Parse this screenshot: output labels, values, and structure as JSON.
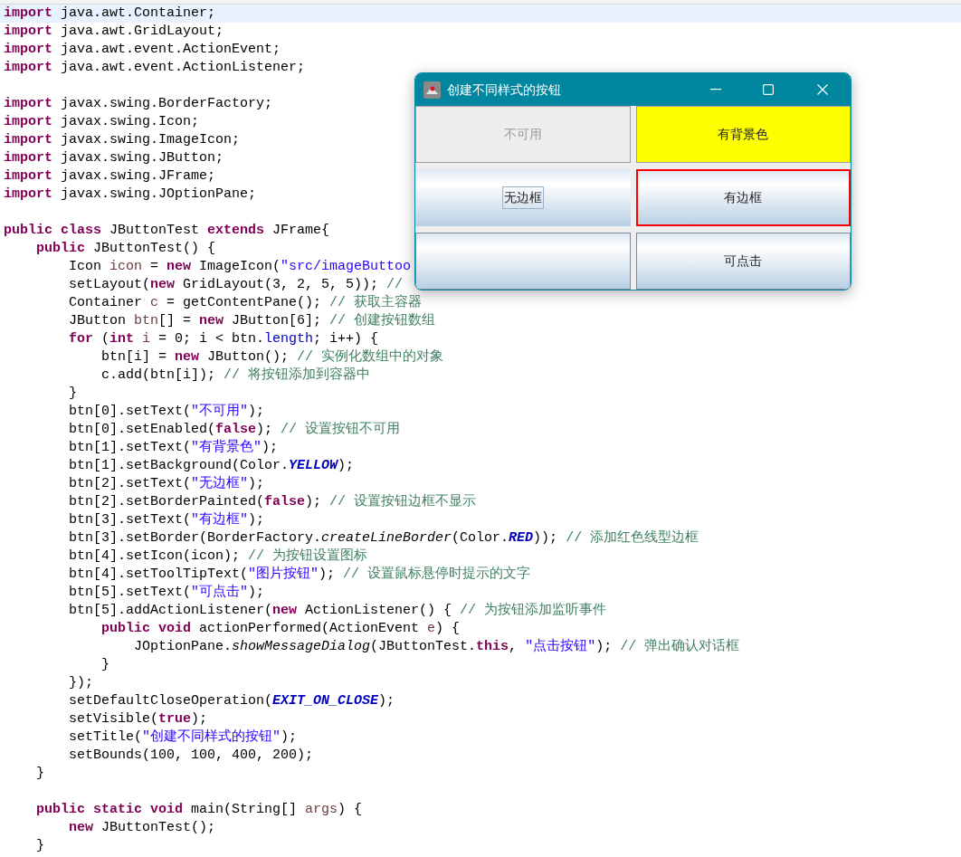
{
  "editor": {
    "lines": [
      {
        "kind": "code",
        "current": true,
        "tokens": [
          {
            "kind": "kw",
            "text": "import"
          },
          {
            "kind": "p",
            "text": " java.awt.Container;"
          }
        ]
      },
      {
        "kind": "code",
        "tokens": [
          {
            "kind": "kw",
            "text": "import"
          },
          {
            "kind": "p",
            "text": " java.awt.GridLayout;"
          }
        ]
      },
      {
        "kind": "code",
        "tokens": [
          {
            "kind": "kw",
            "text": "import"
          },
          {
            "kind": "p",
            "text": " java.awt.event.ActionEvent;"
          }
        ]
      },
      {
        "kind": "code",
        "tokens": [
          {
            "kind": "kw",
            "text": "import"
          },
          {
            "kind": "p",
            "text": " java.awt.event.ActionListener;"
          }
        ]
      },
      {
        "kind": "blank"
      },
      {
        "kind": "code",
        "tokens": [
          {
            "kind": "kw",
            "text": "import"
          },
          {
            "kind": "p",
            "text": " javax.swing.BorderFactory;"
          }
        ]
      },
      {
        "kind": "code",
        "tokens": [
          {
            "kind": "kw",
            "text": "import"
          },
          {
            "kind": "p",
            "text": " javax.swing.Icon;"
          }
        ]
      },
      {
        "kind": "code",
        "tokens": [
          {
            "kind": "kw",
            "text": "import"
          },
          {
            "kind": "p",
            "text": " javax.swing.ImageIcon;"
          }
        ]
      },
      {
        "kind": "code",
        "tokens": [
          {
            "kind": "kw",
            "text": "import"
          },
          {
            "kind": "p",
            "text": " javax.swing.JButton;"
          }
        ]
      },
      {
        "kind": "code",
        "tokens": [
          {
            "kind": "kw",
            "text": "import"
          },
          {
            "kind": "p",
            "text": " javax.swing.JFrame;"
          }
        ]
      },
      {
        "kind": "code",
        "tokens": [
          {
            "kind": "kw",
            "text": "import"
          },
          {
            "kind": "p",
            "text": " javax.swing.JOptionPane;"
          }
        ]
      },
      {
        "kind": "blank"
      },
      {
        "kind": "code",
        "tokens": [
          {
            "kind": "kw",
            "text": "public class"
          },
          {
            "kind": "p",
            "text": " JButtonTest "
          },
          {
            "kind": "kw",
            "text": "extends"
          },
          {
            "kind": "p",
            "text": " JFrame{"
          }
        ],
        "children": [
          {
            "kind": "code",
            "tokens": [
              {
                "kind": "kw",
                "text": "public"
              },
              {
                "kind": "p",
                "text": " JButtonTest() {"
              }
            ],
            "children": [
              {
                "kind": "code",
                "tokens": [
                  {
                    "kind": "p",
                    "text": "Icon "
                  },
                  {
                    "kind": "var",
                    "text": "icon"
                  },
                  {
                    "kind": "p",
                    "text": " = "
                  },
                  {
                    "kind": "kw",
                    "text": "new"
                  },
                  {
                    "kind": "p",
                    "text": " ImageIcon("
                  },
                  {
                    "kind": "str",
                    "text": "\"src/imageButtoo"
                  }
                ]
              },
              {
                "kind": "code",
                "tokens": [
                  {
                    "kind": "p",
                    "text": "setLayout("
                  },
                  {
                    "kind": "kw",
                    "text": "new"
                  },
                  {
                    "kind": "p",
                    "text": " GridLayout(3, 2, 5, 5)); "
                  },
                  {
                    "kind": "cm",
                    "text": "//"
                  }
                ]
              },
              {
                "kind": "code",
                "tokens": [
                  {
                    "kind": "p",
                    "text": "Container "
                  },
                  {
                    "kind": "var",
                    "text": "c"
                  },
                  {
                    "kind": "p",
                    "text": " = getContentPane(); "
                  },
                  {
                    "kind": "cm",
                    "text": "// 获取主容器"
                  }
                ]
              },
              {
                "kind": "code",
                "tokens": [
                  {
                    "kind": "p",
                    "text": "JButton "
                  },
                  {
                    "kind": "var",
                    "text": "btn"
                  },
                  {
                    "kind": "p",
                    "text": "[] = "
                  },
                  {
                    "kind": "kw",
                    "text": "new"
                  },
                  {
                    "kind": "p",
                    "text": " JButton[6]; "
                  },
                  {
                    "kind": "cm",
                    "text": "// 创建按钮数组"
                  }
                ]
              },
              {
                "kind": "code",
                "tokens": [
                  {
                    "kind": "kw",
                    "text": "for"
                  },
                  {
                    "kind": "p",
                    "text": " ("
                  },
                  {
                    "kind": "kw",
                    "text": "int"
                  },
                  {
                    "kind": "var",
                    "text": " i"
                  },
                  {
                    "kind": "p",
                    "text": " = 0; i < btn."
                  },
                  {
                    "kind": "fld",
                    "text": "length"
                  },
                  {
                    "kind": "p",
                    "text": "; i++) {"
                  }
                ],
                "children": [
                  {
                    "kind": "code",
                    "tokens": [
                      {
                        "kind": "p",
                        "text": "btn[i] = "
                      },
                      {
                        "kind": "kw",
                        "text": "new"
                      },
                      {
                        "kind": "p",
                        "text": " JButton(); "
                      },
                      {
                        "kind": "cm",
                        "text": "// 实例化数组中的对象"
                      }
                    ]
                  },
                  {
                    "kind": "code",
                    "tokens": [
                      {
                        "kind": "p",
                        "text": "c.add(btn[i]); "
                      },
                      {
                        "kind": "cm",
                        "text": "// 将按钮添加到容器中"
                      }
                    ]
                  }
                ]
              },
              {
                "kind": "code",
                "tokens": [
                  {
                    "kind": "p",
                    "text": "}"
                  }
                ]
              },
              {
                "kind": "code",
                "tokens": [
                  {
                    "kind": "p",
                    "text": "btn[0].setText("
                  },
                  {
                    "kind": "str",
                    "text": "\"不可用\""
                  },
                  {
                    "kind": "p",
                    "text": ");"
                  }
                ]
              },
              {
                "kind": "code",
                "tokens": [
                  {
                    "kind": "p",
                    "text": "btn[0].setEnabled("
                  },
                  {
                    "kind": "kw",
                    "text": "false"
                  },
                  {
                    "kind": "p",
                    "text": "); "
                  },
                  {
                    "kind": "cm",
                    "text": "// 设置按钮不可用"
                  }
                ]
              },
              {
                "kind": "code",
                "tokens": [
                  {
                    "kind": "p",
                    "text": "btn[1].setText("
                  },
                  {
                    "kind": "str",
                    "text": "\"有背景色\""
                  },
                  {
                    "kind": "p",
                    "text": ");"
                  }
                ]
              },
              {
                "kind": "code",
                "tokens": [
                  {
                    "kind": "p",
                    "text": "btn[1].setBackground(Color."
                  },
                  {
                    "kind": "const",
                    "text": "YELLOW"
                  },
                  {
                    "kind": "p",
                    "text": ");"
                  }
                ]
              },
              {
                "kind": "code",
                "tokens": [
                  {
                    "kind": "p",
                    "text": "btn[2].setText("
                  },
                  {
                    "kind": "str",
                    "text": "\"无边框\""
                  },
                  {
                    "kind": "p",
                    "text": ");"
                  }
                ]
              },
              {
                "kind": "code",
                "tokens": [
                  {
                    "kind": "p",
                    "text": "btn[2].setBorderPainted("
                  },
                  {
                    "kind": "kw",
                    "text": "false"
                  },
                  {
                    "kind": "p",
                    "text": "); "
                  },
                  {
                    "kind": "cm",
                    "text": "// 设置按钮边框不显示"
                  }
                ]
              },
              {
                "kind": "code",
                "tokens": [
                  {
                    "kind": "p",
                    "text": "btn[3].setText("
                  },
                  {
                    "kind": "str",
                    "text": "\"有边框\""
                  },
                  {
                    "kind": "p",
                    "text": ");"
                  }
                ]
              },
              {
                "kind": "code",
                "tokens": [
                  {
                    "kind": "p",
                    "text": "btn[3].setBorder(BorderFactory."
                  },
                  {
                    "kind": "it",
                    "text": "createLineBorder"
                  },
                  {
                    "kind": "p",
                    "text": "(Color."
                  },
                  {
                    "kind": "const",
                    "text": "RED"
                  },
                  {
                    "kind": "p",
                    "text": ")); "
                  },
                  {
                    "kind": "cm",
                    "text": "// 添加红色线型边框"
                  }
                ]
              },
              {
                "kind": "code",
                "tokens": [
                  {
                    "kind": "p",
                    "text": "btn[4].setIcon(icon); "
                  },
                  {
                    "kind": "cm",
                    "text": "// 为按钮设置图标"
                  }
                ]
              },
              {
                "kind": "code",
                "tokens": [
                  {
                    "kind": "p",
                    "text": "btn[4].setToolTipText("
                  },
                  {
                    "kind": "str",
                    "text": "\"图片按钮\""
                  },
                  {
                    "kind": "p",
                    "text": "); "
                  },
                  {
                    "kind": "cm",
                    "text": "// 设置鼠标悬停时提示的文字"
                  }
                ]
              },
              {
                "kind": "code",
                "tokens": [
                  {
                    "kind": "p",
                    "text": "btn[5].setText("
                  },
                  {
                    "kind": "str",
                    "text": "\"可点击\""
                  },
                  {
                    "kind": "p",
                    "text": ");"
                  }
                ]
              },
              {
                "kind": "code",
                "tokens": [
                  {
                    "kind": "p",
                    "text": "btn[5].addActionListener("
                  },
                  {
                    "kind": "kw",
                    "text": "new"
                  },
                  {
                    "kind": "p",
                    "text": " ActionListener() { "
                  },
                  {
                    "kind": "cm",
                    "text": "// 为按钮添加监听事件"
                  }
                ],
                "children": [
                  {
                    "kind": "code",
                    "tokens": [
                      {
                        "kind": "kw",
                        "text": "public void"
                      },
                      {
                        "kind": "p",
                        "text": " actionPerformed(ActionEvent "
                      },
                      {
                        "kind": "var",
                        "text": "e"
                      },
                      {
                        "kind": "p",
                        "text": ") {"
                      }
                    ],
                    "children": [
                      {
                        "kind": "code",
                        "tokens": [
                          {
                            "kind": "p",
                            "text": "JOptionPane."
                          },
                          {
                            "kind": "it",
                            "text": "showMessageDialog"
                          },
                          {
                            "kind": "p",
                            "text": "(JButtonTest."
                          },
                          {
                            "kind": "kw",
                            "text": "this"
                          },
                          {
                            "kind": "p",
                            "text": ", "
                          },
                          {
                            "kind": "str",
                            "text": "\"点击按钮\""
                          },
                          {
                            "kind": "p",
                            "text": "); "
                          },
                          {
                            "kind": "cm",
                            "text": "// 弹出确认对话框"
                          }
                        ]
                      }
                    ]
                  },
                  {
                    "kind": "code",
                    "tokens": [
                      {
                        "kind": "p",
                        "text": "}"
                      }
                    ]
                  }
                ]
              },
              {
                "kind": "code",
                "tokens": [
                  {
                    "kind": "p",
                    "text": "});"
                  }
                ]
              },
              {
                "kind": "code",
                "tokens": [
                  {
                    "kind": "p",
                    "text": "setDefaultCloseOperation("
                  },
                  {
                    "kind": "const",
                    "text": "EXIT_ON_CLOSE"
                  },
                  {
                    "kind": "p",
                    "text": ");"
                  }
                ]
              },
              {
                "kind": "code",
                "tokens": [
                  {
                    "kind": "p",
                    "text": "setVisible("
                  },
                  {
                    "kind": "kw",
                    "text": "true"
                  },
                  {
                    "kind": "p",
                    "text": ");"
                  }
                ]
              },
              {
                "kind": "code",
                "tokens": [
                  {
                    "kind": "p",
                    "text": "setTitle("
                  },
                  {
                    "kind": "str",
                    "text": "\"创建不同样式的按钮\""
                  },
                  {
                    "kind": "p",
                    "text": ");"
                  }
                ]
              },
              {
                "kind": "code",
                "tokens": [
                  {
                    "kind": "p",
                    "text": "setBounds(100, 100, 400, 200);"
                  }
                ]
              }
            ]
          },
          {
            "kind": "code",
            "tokens": [
              {
                "kind": "p",
                "text": "}"
              }
            ]
          },
          {
            "kind": "blank"
          },
          {
            "kind": "code",
            "tokens": [
              {
                "kind": "kw",
                "text": "public static void"
              },
              {
                "kind": "p",
                "text": " main(String[] "
              },
              {
                "kind": "var",
                "text": "args"
              },
              {
                "kind": "p",
                "text": ") {"
              }
            ],
            "children": [
              {
                "kind": "code",
                "tokens": [
                  {
                    "kind": "kw",
                    "text": "new"
                  },
                  {
                    "kind": "p",
                    "text": " JButtonTest();"
                  }
                ]
              }
            ]
          },
          {
            "kind": "code",
            "tokens": [
              {
                "kind": "p",
                "text": "}"
              }
            ]
          }
        ]
      }
    ]
  },
  "window": {
    "title": "创建不同样式的按钮",
    "buttons": [
      {
        "kind": "plain",
        "label": "不可用",
        "disabled": true,
        "focused": false
      },
      {
        "kind": "colored",
        "label": "有背景色",
        "color": "#ffff00",
        "disabled": false,
        "focused": false
      },
      {
        "kind": "borderless",
        "label": "无边框",
        "disabled": false,
        "focused": true
      },
      {
        "kind": "red-border",
        "label": "有边框",
        "disabled": false,
        "focused": false
      },
      {
        "kind": "plain",
        "disabled": false,
        "focused": false
      },
      {
        "kind": "plain",
        "label": "可点击",
        "disabled": false,
        "focused": false
      }
    ]
  }
}
